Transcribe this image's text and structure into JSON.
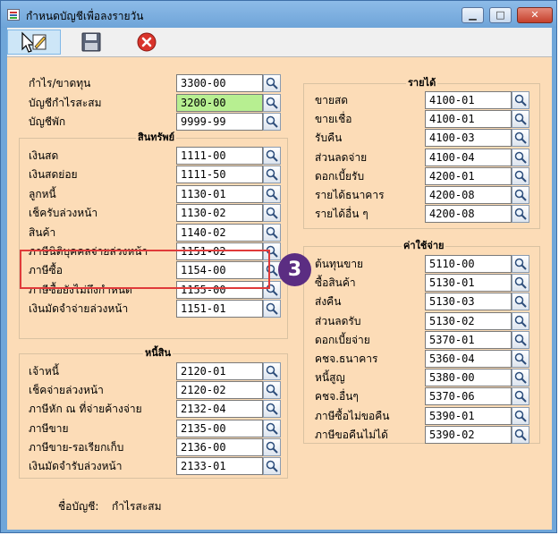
{
  "window": {
    "title": "กำหนดบัญชีเพื่อลงรายวัน"
  },
  "top": [
    {
      "label": "กำไร/ขาดทุน",
      "code": "3300-00"
    },
    {
      "label": "บัญชีกำไรสะสม",
      "code": "3200-00"
    },
    {
      "label": "บัญชีพัก",
      "code": "9999-99"
    }
  ],
  "assets": {
    "title": "สินทรัพย์",
    "rows": [
      {
        "label": "เงินสด",
        "code": "1111-00"
      },
      {
        "label": "เงินสดย่อย",
        "code": "1111-50"
      },
      {
        "label": "ลูกหนี้",
        "code": "1130-01"
      },
      {
        "label": "เช็ครับล่วงหน้า",
        "code": "1130-02"
      },
      {
        "label": "สินค้า",
        "code": "1140-02"
      },
      {
        "label": "ภาษีนิติบุคคลจ่ายล่วงหน้า",
        "code": "1151-02"
      },
      {
        "label": "ภาษีซื้อ",
        "code": "1154-00"
      },
      {
        "label": "ภาษีซื้อยังไม่ถึงกำหนด",
        "code": "1155-00"
      },
      {
        "label": "เงินมัดจำจ่ายล่วงหน้า",
        "code": "1151-01"
      }
    ]
  },
  "liabilities": {
    "title": "หนี้สิน",
    "rows": [
      {
        "label": "เจ้าหนี้",
        "code": "2120-01"
      },
      {
        "label": "เช็คจ่ายล่วงหน้า",
        "code": "2120-02"
      },
      {
        "label": "ภาษีหัก ณ ที่จ่ายค้างจ่าย",
        "code": "2132-04"
      },
      {
        "label": "ภาษีขาย",
        "code": "2135-00"
      },
      {
        "label": "ภาษีขาย-รอเรียกเก็บ",
        "code": "2136-00"
      },
      {
        "label": "เงินมัดจำรับล่วงหน้า",
        "code": "2133-01"
      }
    ]
  },
  "income": {
    "title": "รายได้",
    "rows": [
      {
        "label": "ขายสด",
        "code": "4100-01"
      },
      {
        "label": "ขายเชื่อ",
        "code": "4100-01"
      },
      {
        "label": "รับคืน",
        "code": "4100-03"
      },
      {
        "label": "ส่วนลดจ่าย",
        "code": "4100-04"
      },
      {
        "label": "ดอกเบี้ยรับ",
        "code": "4200-01"
      },
      {
        "label": "รายได้ธนาคาร",
        "code": "4200-08"
      },
      {
        "label": "รายได้อื่น ๆ",
        "code": "4200-08"
      }
    ]
  },
  "expenses": {
    "title": "ค่าใช้จ่าย",
    "rows": [
      {
        "label": "ต้นทุนขาย",
        "code": "5110-00"
      },
      {
        "label": "ซื้อสินค้า",
        "code": "5130-01"
      },
      {
        "label": "ส่งคืน",
        "code": "5130-03"
      },
      {
        "label": "ส่วนลดรับ",
        "code": "5130-02"
      },
      {
        "label": "ดอกเบี้ยจ่าย",
        "code": "5370-01"
      },
      {
        "label": "คชจ.ธนาคาร",
        "code": "5360-04"
      },
      {
        "label": "หนี้สูญ",
        "code": "5380-00"
      },
      {
        "label": "คชจ.อื่นๆ",
        "code": "5370-06"
      },
      {
        "label": "ภาษีซื้อไม่ขอคืน",
        "code": "5390-01"
      },
      {
        "label": "ภาษีขอคืนไม่ได้",
        "code": "5390-02"
      }
    ]
  },
  "footer": {
    "label": "ชื่อบัญชี:",
    "value": "กำไรสะสม"
  },
  "annotation": {
    "step": "3"
  },
  "icons": {
    "edit": "edit-pointer-icon",
    "save": "floppy-disk-icon",
    "cancel": "cancel-x-icon",
    "lookup": "magnifier-icon"
  },
  "colors": {
    "form_background": "#fcdcb7",
    "active_field": "#b7ef91",
    "highlight_border": "#e03a3a",
    "badge": "#5b2d82"
  }
}
